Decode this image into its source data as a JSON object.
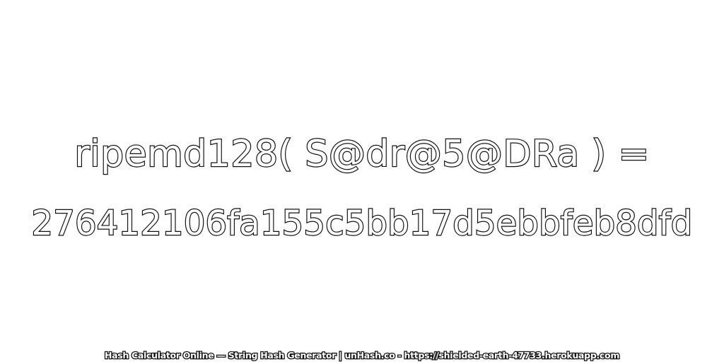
{
  "expression": "ripemd128( S@dr@5@DRa ) =",
  "hash": "276412106fa155c5bb17d5ebbfeb8dfd",
  "footer": "Hash Calculator Online — String Hash Generator | unHash.co - https://shielded-earth-47733.herokuapp.com",
  "colors": {
    "background": "#ffffff",
    "text_fill": "#ffffff",
    "text_outline": "#111111"
  }
}
